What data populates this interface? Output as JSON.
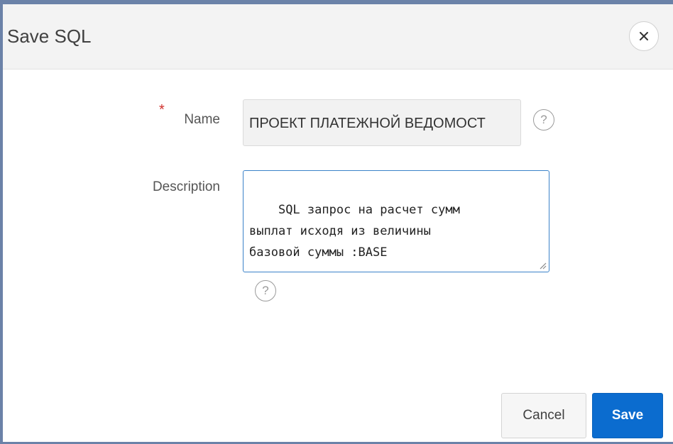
{
  "dialog": {
    "title": "Save SQL",
    "close_icon": "close-icon"
  },
  "form": {
    "name": {
      "label": "Name",
      "required_mark": "*",
      "value": "ПРОЕКТ ПЛАТЕЖНОЙ ВЕДОМОСТ",
      "help_icon": "help-icon",
      "help_glyph": "?"
    },
    "description": {
      "label": "Description",
      "value": "SQL запрос на расчет сумм\nвыплат исходя из величины\nбазовой суммы :BASE",
      "help_icon": "help-icon",
      "help_glyph": "?"
    }
  },
  "buttons": {
    "cancel_label": "Cancel",
    "save_label": "Save"
  },
  "colors": {
    "accent": "#0b6ccf",
    "frame": "#6b82a8",
    "required": "#d0312d",
    "focus_border": "#3b82c9"
  }
}
